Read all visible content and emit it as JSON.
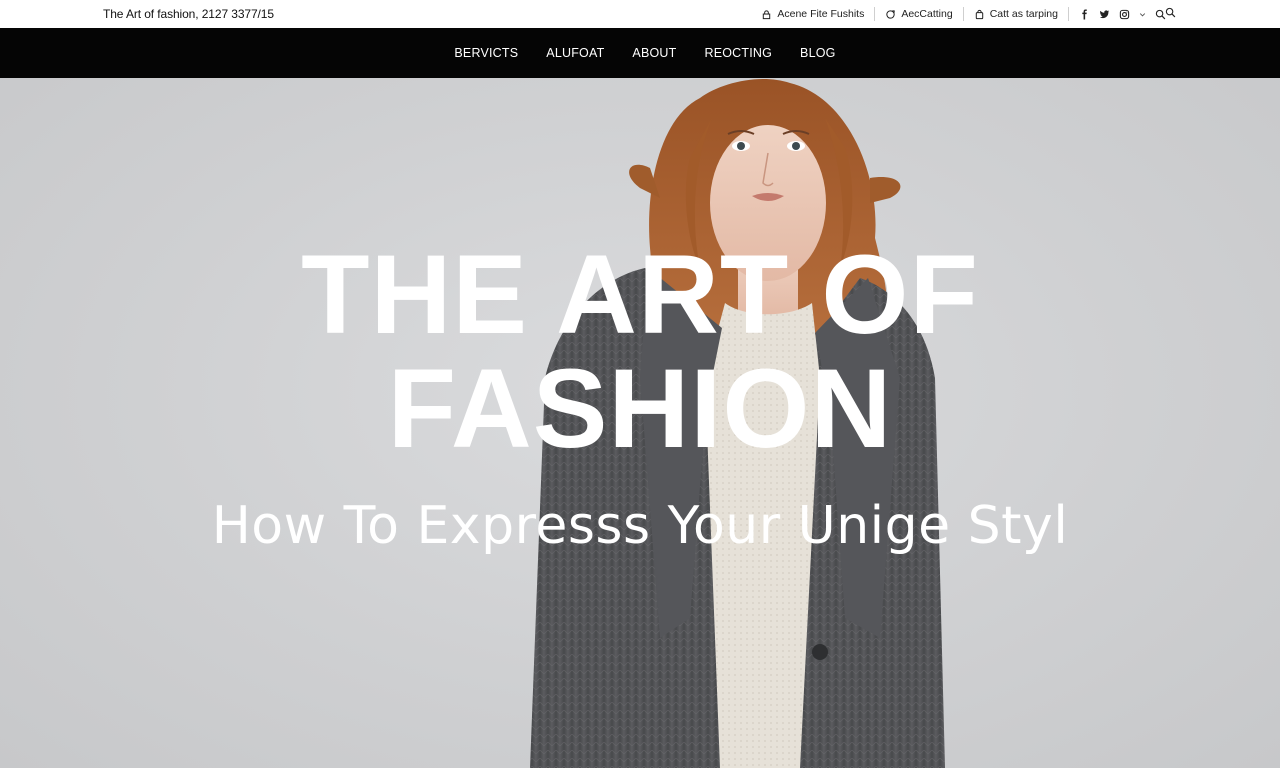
{
  "topbar": {
    "site_info": "The Art of fashion, 2127 3377/15",
    "links": [
      {
        "label": "Acene Fite Fushits",
        "icon": "lock-icon"
      },
      {
        "label": "AecCatting",
        "icon": "refresh-icon"
      },
      {
        "label": "Catt as tarping",
        "icon": "bag-icon"
      }
    ],
    "social_icons": [
      "facebook-icon",
      "twitter-icon",
      "instagram-icon",
      "chevron-down-icon",
      "search-icon"
    ]
  },
  "nav": {
    "items": [
      "BERVICTS",
      "ALUFOAT",
      "ABOUT",
      "REOCTING",
      "BLOG"
    ]
  },
  "hero": {
    "title_line1": "THE ART OF",
    "title_line2": "FASHION",
    "subtitle": "How To Expresss Your Unige Styl"
  },
  "colors": {
    "nav_bg": "#050505",
    "hero_bg": "#d2d3d5",
    "hero_text": "#ffffff",
    "coat": "#4a4b4e",
    "hair": "#a55a2a"
  }
}
